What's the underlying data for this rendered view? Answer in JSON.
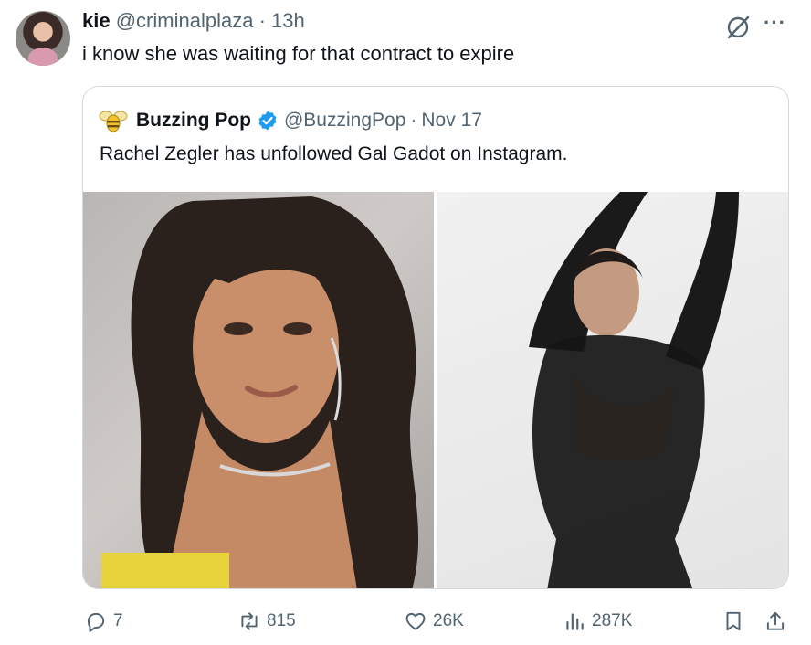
{
  "tweet": {
    "author_name": "kie",
    "author_handle": "@criminalplaza",
    "separator": "·",
    "time": "13h",
    "text": "i know she was waiting for that contract to expire"
  },
  "quoted_tweet": {
    "author_name": "Buzzing Pop",
    "author_handle": "@BuzzingPop",
    "separator": "·",
    "date": "Nov 17",
    "verified": true,
    "text": "Rachel Zegler has unfollowed Gal Gadot on Instagram.",
    "photos": [
      "photo-left",
      "photo-right"
    ]
  },
  "actions": {
    "replies": "7",
    "reposts": "815",
    "likes": "26K",
    "views": "287K"
  },
  "icons": {
    "grok": "grok-icon",
    "more": "more-icon",
    "reply": "reply-icon",
    "repost": "repost-icon",
    "like": "heart-icon",
    "views": "views-icon",
    "bookmark": "bookmark-icon",
    "share": "share-icon"
  },
  "colors": {
    "text": "#0f1419",
    "secondary": "#536471",
    "border": "#cfd9de",
    "verified": "#1d9bf0"
  }
}
